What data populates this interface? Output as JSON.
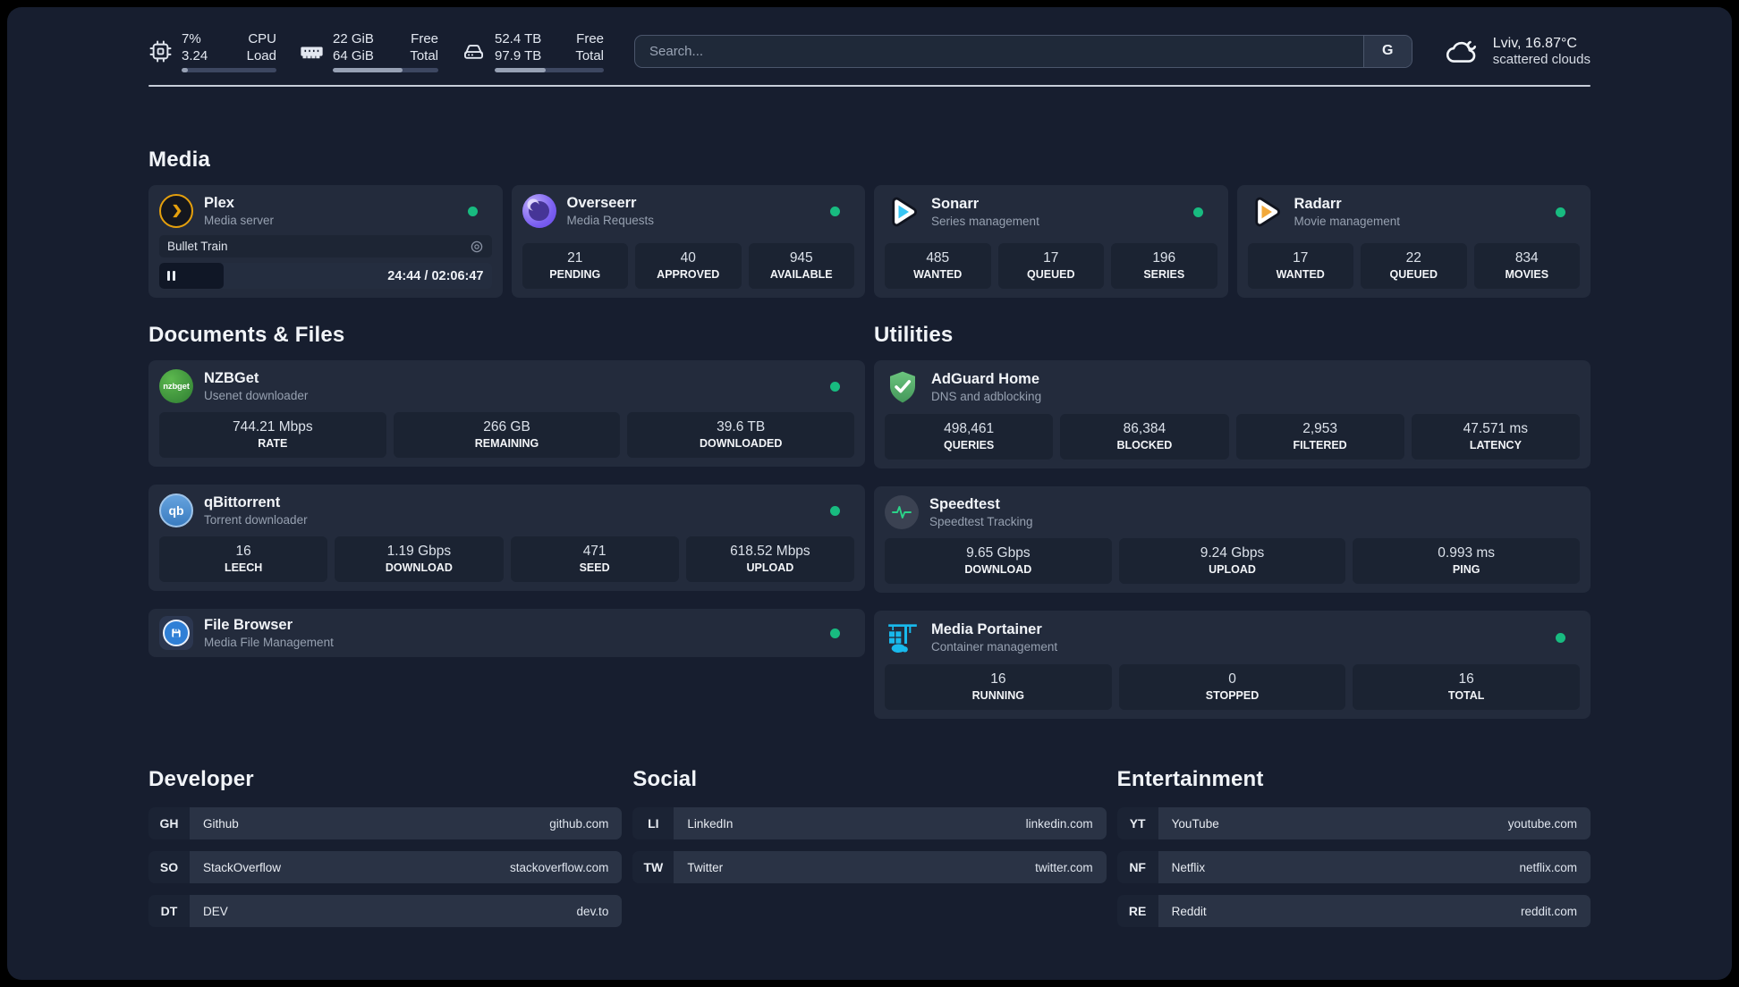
{
  "colors": {
    "status_online": "#18bb80",
    "background": "#171e2f",
    "card": "#232b3c",
    "accent_amber": "#e5a00d"
  },
  "top_bar": {
    "system_stats": [
      {
        "icon": "cpu-icon",
        "rows": [
          {
            "value": "7%",
            "label": "CPU"
          },
          {
            "value": "3.24",
            "label": "Load"
          }
        ],
        "progress_pct": 7
      },
      {
        "icon": "ram-icon",
        "rows": [
          {
            "value": "22 GiB",
            "label": "Free"
          },
          {
            "value": "64 GiB",
            "label": "Total"
          }
        ],
        "progress_pct": 66
      },
      {
        "icon": "disk-icon",
        "rows": [
          {
            "value": "52.4 TB",
            "label": "Free"
          },
          {
            "value": "97.9 TB",
            "label": "Total"
          }
        ],
        "progress_pct": 47
      }
    ],
    "search": {
      "placeholder": "Search...",
      "engine_button": "G"
    },
    "weather": {
      "location": "Lviv, 16.87°C",
      "condition": "scattered clouds"
    }
  },
  "media": {
    "title": "Media",
    "cards": [
      {
        "name": "Plex",
        "subtitle": "Media server",
        "online": true,
        "now_playing": {
          "title": "Bullet Train",
          "time": "24:44 / 02:06:47",
          "progress_pct": 19.5,
          "state": "paused"
        }
      },
      {
        "name": "Overseerr",
        "subtitle": "Media Requests",
        "online": true,
        "stats": [
          {
            "value": "21",
            "label": "PENDING"
          },
          {
            "value": "40",
            "label": "APPROVED"
          },
          {
            "value": "945",
            "label": "AVAILABLE"
          }
        ]
      },
      {
        "name": "Sonarr",
        "subtitle": "Series management",
        "online": true,
        "stats": [
          {
            "value": "485",
            "label": "WANTED"
          },
          {
            "value": "17",
            "label": "QUEUED"
          },
          {
            "value": "196",
            "label": "SERIES"
          }
        ]
      },
      {
        "name": "Radarr",
        "subtitle": "Movie management",
        "online": true,
        "stats": [
          {
            "value": "17",
            "label": "WANTED"
          },
          {
            "value": "22",
            "label": "QUEUED"
          },
          {
            "value": "834",
            "label": "MOVIES"
          }
        ]
      }
    ]
  },
  "documents": {
    "title": "Documents & Files",
    "cards": [
      {
        "name": "NZBGet",
        "subtitle": "Usenet downloader",
        "online": true,
        "stats": [
          {
            "value": "744.21 Mbps",
            "label": "RATE"
          },
          {
            "value": "266 GB",
            "label": "REMAINING"
          },
          {
            "value": "39.6 TB",
            "label": "DOWNLOADED"
          }
        ]
      },
      {
        "name": "qBittorrent",
        "subtitle": "Torrent downloader",
        "online": true,
        "stats": [
          {
            "value": "16",
            "label": "LEECH"
          },
          {
            "value": "1.19 Gbps",
            "label": "DOWNLOAD"
          },
          {
            "value": "471",
            "label": "SEED"
          },
          {
            "value": "618.52 Mbps",
            "label": "UPLOAD"
          }
        ]
      },
      {
        "name": "File Browser",
        "subtitle": "Media File Management",
        "online": true
      }
    ]
  },
  "utilities": {
    "title": "Utilities",
    "cards": [
      {
        "name": "AdGuard Home",
        "subtitle": "DNS and adblocking",
        "stats": [
          {
            "value": "498,461",
            "label": "QUERIES"
          },
          {
            "value": "86,384",
            "label": "BLOCKED"
          },
          {
            "value": "2,953",
            "label": "FILTERED"
          },
          {
            "value": "47.571 ms",
            "label": "LATENCY"
          }
        ]
      },
      {
        "name": "Speedtest",
        "subtitle": "Speedtest Tracking",
        "stats": [
          {
            "value": "9.65 Gbps",
            "label": "DOWNLOAD"
          },
          {
            "value": "9.24 Gbps",
            "label": "UPLOAD"
          },
          {
            "value": "0.993 ms",
            "label": "PING"
          }
        ]
      },
      {
        "name": "Media Portainer",
        "subtitle": "Container management",
        "online": true,
        "stats": [
          {
            "value": "16",
            "label": "RUNNING"
          },
          {
            "value": "0",
            "label": "STOPPED"
          },
          {
            "value": "16",
            "label": "TOTAL"
          }
        ]
      }
    ]
  },
  "link_sections": [
    {
      "title": "Developer",
      "links": [
        {
          "abbr": "GH",
          "name": "Github",
          "url": "github.com"
        },
        {
          "abbr": "SO",
          "name": "StackOverflow",
          "url": "stackoverflow.com"
        },
        {
          "abbr": "DT",
          "name": "DEV",
          "url": "dev.to"
        }
      ]
    },
    {
      "title": "Social",
      "links": [
        {
          "abbr": "LI",
          "name": "LinkedIn",
          "url": "linkedin.com"
        },
        {
          "abbr": "TW",
          "name": "Twitter",
          "url": "twitter.com"
        }
      ]
    },
    {
      "title": "Entertainment",
      "links": [
        {
          "abbr": "YT",
          "name": "YouTube",
          "url": "youtube.com"
        },
        {
          "abbr": "NF",
          "name": "Netflix",
          "url": "netflix.com"
        },
        {
          "abbr": "RE",
          "name": "Reddit",
          "url": "reddit.com"
        }
      ]
    }
  ]
}
